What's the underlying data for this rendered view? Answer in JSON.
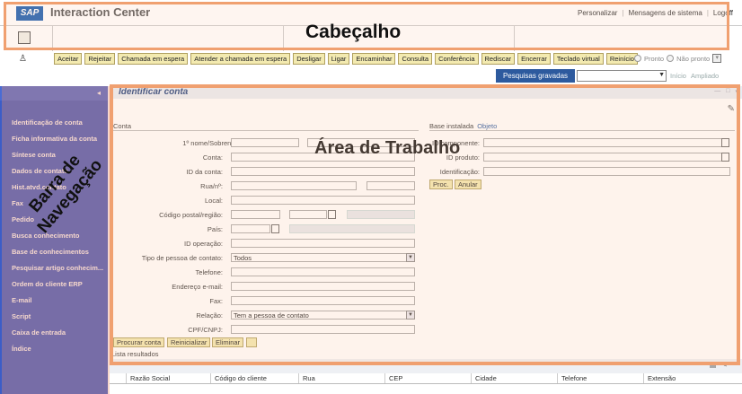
{
  "header": {
    "logo": "SAP",
    "app_title": "Interaction Center",
    "links": [
      "Personalizar",
      "Mensagens de sistema",
      "Logoff"
    ],
    "overlay_caption": "Cabeçalho"
  },
  "toolbar": {
    "buttons": [
      "Aceitar",
      "Rejeitar",
      "Chamada em espera",
      "Atender a chamada em espera",
      "Desligar",
      "Ligar",
      "Encaminhar",
      "Consulta",
      "Conferência",
      "Rediscar",
      "Encerrar",
      "Teclado virtual",
      "Reinício"
    ],
    "status_ready": "Pronto",
    "status_not_ready": "Não pronto"
  },
  "searchbar": {
    "saved_searches": "Pesquisas gravadas",
    "start": "Início",
    "expanded": "Ampliado"
  },
  "sidebar": {
    "items": [
      "Identificação de conta",
      "Ficha informativa da conta",
      "Síntese conta",
      "Dados de contato",
      "Hist.atvd.contato",
      "Fax",
      "Pedido",
      "Busca conhecimento",
      "Base de conhecimentos",
      "Pesquisar artigo conhecim...",
      "Ordem do cliente ERP",
      "E-mail",
      "Script",
      "Caixa de entrada",
      "Índice"
    ],
    "overlay_caption_line1": "Barra de",
    "overlay_caption_line2": "Navegação"
  },
  "workspace": {
    "title": "Identificar conta",
    "overlay_caption": "Área de Trabalho",
    "section_account": "Conta",
    "labels": {
      "first_last_name": "1º nome/Sobrenome:",
      "account": "Conta:",
      "account_id": "ID da conta:",
      "street": "Rua/nº:",
      "city": "Local:",
      "postal_region": "Código postal/região:",
      "country": "País:",
      "operation_id": "ID operação:",
      "contact_type": "Tipo de pessoa de contato:",
      "phone": "Telefone:",
      "email": "Endereço e-mail:",
      "fax": "Fax:",
      "relation": "Relação:",
      "cpf": "CPF/CNPJ:"
    },
    "contact_type_value": "Todos",
    "relation_value": "Tem a pessoa de contato",
    "tabs": [
      "Base instalada",
      "Objeto"
    ],
    "object_labels": {
      "component_id": "ID componente:",
      "product_id": "ID produto:",
      "identification": "Identificação:"
    },
    "object_buttons": [
      "Proc.",
      "Anular"
    ],
    "search_buttons": [
      "Procurar conta",
      "Reinicializar",
      "Eliminar"
    ],
    "results_title": "Lista resultados",
    "results_columns": [
      "Razão Social",
      "Código do cliente",
      "Rua",
      "CEP",
      "Cidade",
      "Telefone",
      "Extensão"
    ]
  }
}
